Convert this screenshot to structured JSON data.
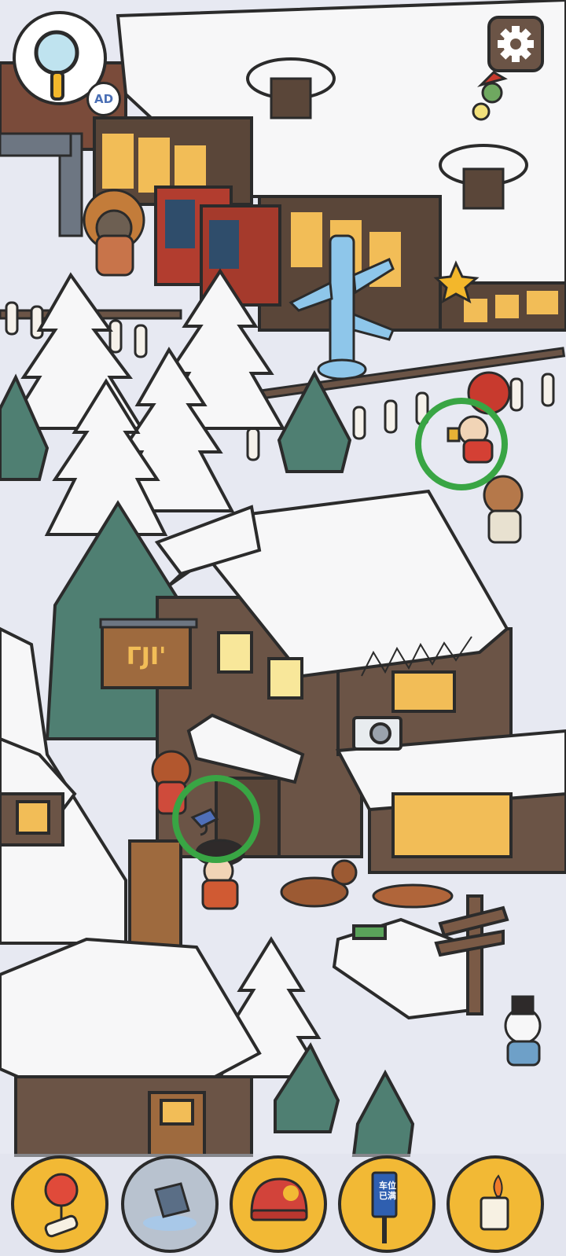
{
  "hud": {
    "ad_badge": "AD",
    "shop_sign_text": "ΓJI'"
  },
  "found_markers": [
    {
      "item": "lighter"
    },
    {
      "item": "hairdryer"
    }
  ],
  "item_bar": {
    "slots": [
      {
        "icon": "balloon-scroll-icon",
        "state": "pending"
      },
      {
        "icon": "spilled-cup-icon",
        "state": "found"
      },
      {
        "icon": "helmet-icon",
        "state": "pending"
      },
      {
        "icon": "parking-sign-icon",
        "state": "pending",
        "sign_text": "车位已满"
      },
      {
        "icon": "lighter-icon",
        "state": "pending"
      }
    ]
  },
  "colors": {
    "snow": "#f7f7f8",
    "ground": "#e7e9f2",
    "wood": "#6b5446",
    "pine": "#4f7f72",
    "slot_gold": "#f2b935",
    "found_circle": "#39a544"
  }
}
